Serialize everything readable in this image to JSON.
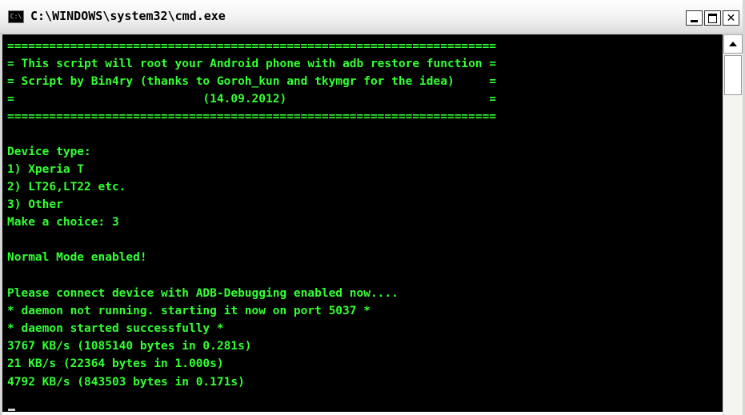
{
  "window": {
    "title": "C:\\WINDOWS\\system32\\cmd.exe",
    "icon": "cmd-icon",
    "icon_text": "C:\\"
  },
  "controls": {
    "minimize": "minimize-icon",
    "maximize": "maximize-icon",
    "close": "close-icon",
    "close_glyph": "✕"
  },
  "console": {
    "text_color": "#33ff33",
    "background": "#000000",
    "lines": [
      "======================================================================",
      "= This script will root your Android phone with adb restore function =",
      "= Script by Bin4ry (thanks to Goroh_kun and tkymgr for the idea)     =",
      "=                           (14.09.2012)                             =",
      "======================================================================",
      "",
      "Device type:",
      "1) Xperia T",
      "2) LT26,LT22 etc.",
      "3) Other",
      "Make a choice: 3",
      "",
      "Normal Mode enabled!",
      "",
      "Please connect device with ADB-Debugging enabled now....",
      "* daemon not running. starting it now on port 5037 *",
      "* daemon started successfully *",
      "3767 KB/s (1085140 bytes in 0.281s)",
      "21 KB/s (22364 bytes in 1.000s)",
      "4792 KB/s (843503 bytes in 0.171s)"
    ]
  }
}
